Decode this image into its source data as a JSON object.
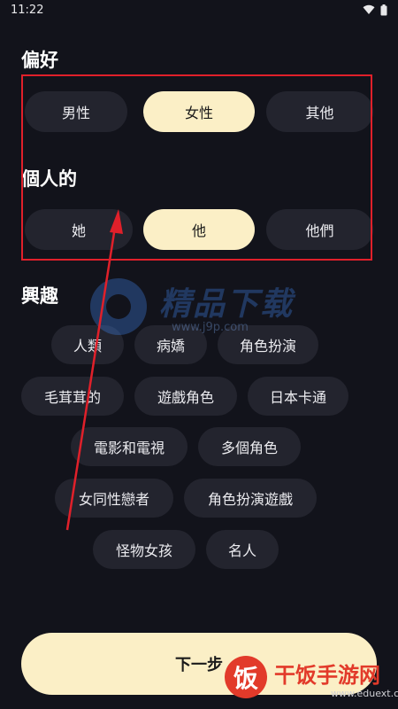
{
  "status_bar": {
    "time": "11:22"
  },
  "preference": {
    "title": "偏好",
    "options": [
      {
        "label": "男性",
        "selected": false
      },
      {
        "label": "女性",
        "selected": true
      },
      {
        "label": "其他",
        "selected": false
      }
    ]
  },
  "pronoun": {
    "title": "個人的",
    "options": [
      {
        "label": "她",
        "selected": false
      },
      {
        "label": "他",
        "selected": true
      },
      {
        "label": "他們",
        "selected": false
      }
    ]
  },
  "interests": {
    "title": "興趣",
    "tags": [
      "人類",
      "病嬌",
      "角色扮演",
      "毛茸茸的",
      "遊戲角色",
      "日本卡通",
      "電影和電視",
      "多個角色",
      "女同性戀者",
      "角色扮演遊戲",
      "怪物女孩",
      "名人"
    ]
  },
  "next_button": {
    "label": "下一步"
  },
  "colors": {
    "background": "#12131b",
    "pill": "#23242e",
    "selected": "#fbefc6",
    "annotation": "#e0202a"
  },
  "watermarks": {
    "center": {
      "title": "精品下载",
      "url": "www.j9p.com"
    },
    "corner": {
      "logo": "饭",
      "title": "干饭手游网",
      "url": "www.eduext.com"
    }
  }
}
